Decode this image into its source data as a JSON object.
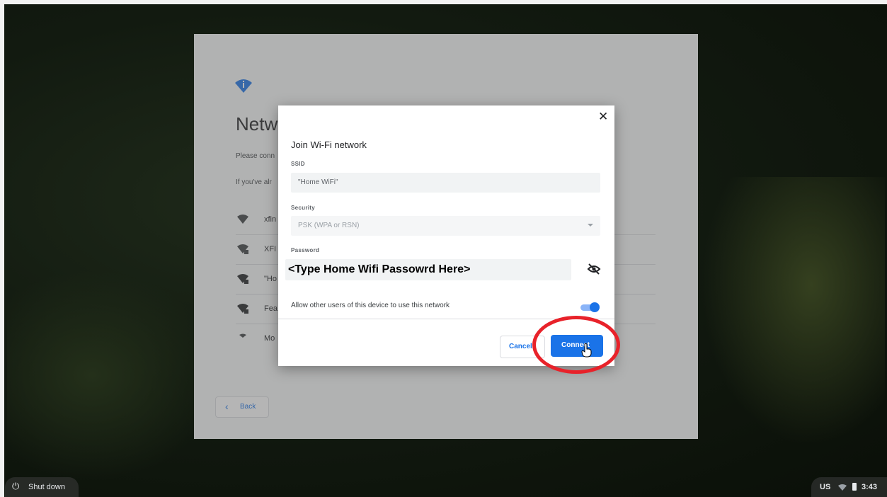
{
  "oobe": {
    "title_visible": "Netw",
    "line1_visible": "Please conn",
    "line2_visible": "If you've alr",
    "networks": [
      {
        "name_visible": "xfin",
        "locked": false
      },
      {
        "name_visible": "XFI",
        "locked": true
      },
      {
        "name_visible": "\"Ho",
        "locked": true
      },
      {
        "name_visible": "Fea",
        "locked": true
      },
      {
        "name_visible": "Mo",
        "locked": false
      }
    ],
    "back_label": "Back"
  },
  "dialog": {
    "title": "Join Wi-Fi network",
    "ssid_label": "SSID",
    "ssid_value": "\"Home WiFi\"",
    "security_label": "Security",
    "security_value": "PSK (WPA or RSN)",
    "password_label": "Password",
    "password_value": "<Type Home Wifi Passowrd Here>",
    "allow_label": "Allow other users of this device to use this network",
    "allow_enabled": true,
    "cancel_label": "Cancel",
    "connect_label": "Connect"
  },
  "shelf": {
    "shutdown_label": "Shut down",
    "lang": "US",
    "time": "3:43"
  },
  "colors": {
    "accent": "#1a73e8",
    "annotation": "#e8222a"
  }
}
